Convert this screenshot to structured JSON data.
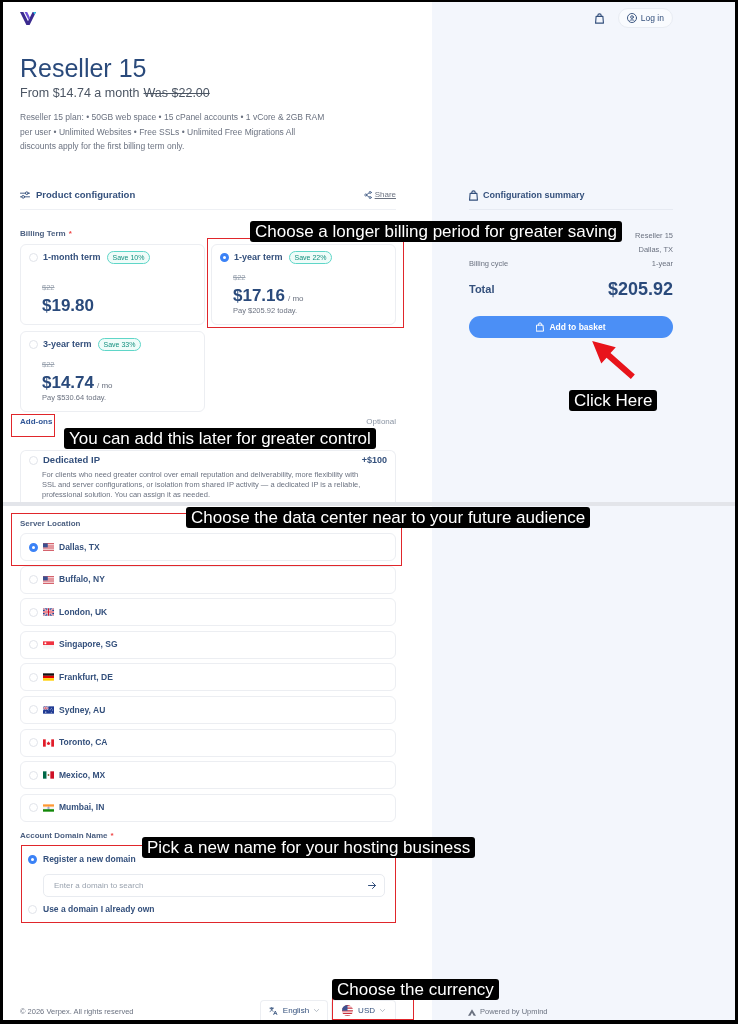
{
  "header": {
    "login": "Log in"
  },
  "product": {
    "title": "Reseller 15",
    "from_price": "From $14.74 a month",
    "was_price": "Was $22.00",
    "description": "Reseller 15 plan: • 50GB web space • 15 cPanel accounts • 1 vCore & 2GB RAM per user • Unlimited Websites • Free SSLs • Unlimited Free Migrations All discounts apply for the first billing term only."
  },
  "configuration": {
    "title": "Product configuration",
    "share": "Share"
  },
  "billing_term": {
    "label": "Billing Term",
    "required": "*",
    "options": [
      {
        "title": "1-month term",
        "badge": "Save 10%",
        "old_price": "$22",
        "price": "$19.80",
        "selected": false
      },
      {
        "title": "1-year term",
        "badge": "Save 22%",
        "old_price": "$22",
        "price": "$17.16",
        "unit": "/ mo",
        "pay_note": "Pay $205.92 today.",
        "selected": true
      },
      {
        "title": "3-year term",
        "badge": "Save 33%",
        "old_price": "$22",
        "price": "$14.74",
        "unit": "/ mo",
        "pay_note": "Pay $530.64 today.",
        "selected": false
      }
    ]
  },
  "addons": {
    "label": "Add-ons",
    "note": "Optional",
    "items": [
      {
        "title": "Dedicated IP",
        "price": "+$100",
        "description": "For clients who need greater control over email reputation and deliverability, more flexibility with SSL and server configurations, or isolation from shared IP activity — a dedicated IP is a reliable, professional solution. You can assign it as needed.",
        "checked": false
      }
    ]
  },
  "server_location": {
    "label": "Server Location",
    "options": [
      {
        "name": "Dallas, TX",
        "kind": "us",
        "selected": true
      },
      {
        "name": "Buffalo, NY",
        "kind": "us",
        "selected": false
      },
      {
        "name": "London, UK",
        "kind": "uk",
        "selected": false
      },
      {
        "name": "Singapore, SG",
        "kind": "sg",
        "selected": false
      },
      {
        "name": "Frankfurt, DE",
        "kind": "de",
        "selected": false
      },
      {
        "name": "Sydney, AU",
        "kind": "au",
        "selected": false
      },
      {
        "name": "Toronto, CA",
        "kind": "ca",
        "selected": false
      },
      {
        "name": "Mexico, MX",
        "kind": "mx",
        "selected": false
      },
      {
        "name": "Mumbai, IN",
        "kind": "in",
        "selected": false
      }
    ]
  },
  "domain": {
    "label": "Account Domain Name",
    "required": "*",
    "options": [
      {
        "label": "Register a new domain",
        "selected": true,
        "search": {
          "placeholder": "Enter a domain to search"
        }
      },
      {
        "label": "Use a domain I already own",
        "selected": false
      }
    ]
  },
  "summary": {
    "title": "Configuration summary",
    "rows": [
      {
        "value": "Reseller 15"
      },
      {
        "value": "Dallas, TX"
      },
      {
        "label": "Billing cycle",
        "value": "1-year"
      }
    ],
    "total": {
      "label": "Total",
      "value": "$205.92"
    },
    "button": "Add to basket"
  },
  "footer": {
    "copyright": "© 2026 Verpex. All rights reserved",
    "language": "English",
    "currency": "USD",
    "powered_by": "Powered by Upmind"
  },
  "callouts": [
    {
      "text": "Choose a longer billing period for greater saving"
    },
    {
      "text": "Click Here"
    },
    {
      "text": "You can add this later for greater control"
    },
    {
      "text": "Choose the data center near to your future audience"
    },
    {
      "text": "Pick a new name for your hosting business"
    },
    {
      "text": "Choose the currency"
    }
  ]
}
